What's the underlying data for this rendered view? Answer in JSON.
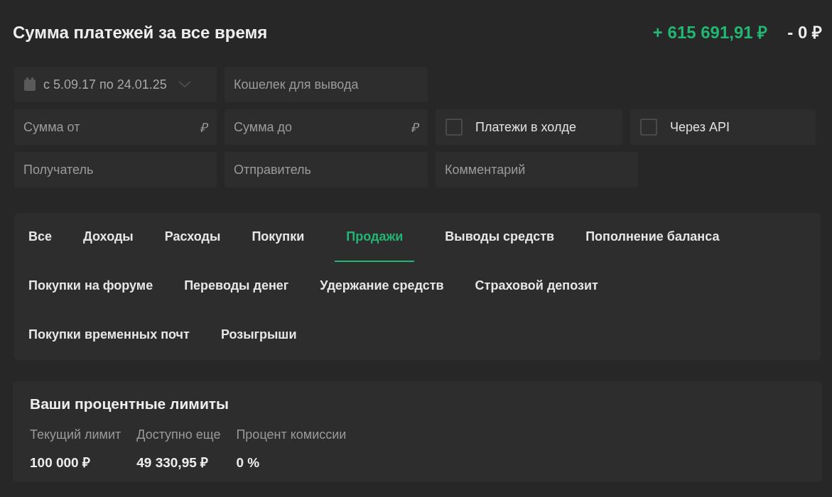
{
  "header": {
    "title": "Сумма платежей за все время",
    "income": "+ 615 691,91 ₽",
    "expense": "- 0 ₽"
  },
  "filters": {
    "date_range": {
      "value": "с 5.09.17 по 24.01.25"
    },
    "wallet": {
      "placeholder": "Кошелек для вывода"
    },
    "amount_from": {
      "placeholder": "Сумма от",
      "suffix": "₽"
    },
    "amount_to": {
      "placeholder": "Сумма до",
      "suffix": "₽"
    },
    "checkboxes": [
      {
        "label": "Платежи в холде",
        "checked": false
      },
      {
        "label": "Через API",
        "checked": false
      }
    ],
    "recipient": {
      "placeholder": "Получатель"
    },
    "sender": {
      "placeholder": "Отправитель"
    },
    "comment": {
      "placeholder": "Комментарий"
    }
  },
  "tabs": [
    {
      "label": "Все",
      "selected": false
    },
    {
      "label": "Доходы",
      "selected": false
    },
    {
      "label": "Расходы",
      "selected": false
    },
    {
      "label": "Покупки",
      "selected": false
    },
    {
      "label": "Продажи",
      "selected": true
    },
    {
      "label": "Выводы средств",
      "selected": false
    },
    {
      "label": "Пополнение баланса",
      "selected": false
    },
    {
      "label": "Покупки на форуме",
      "selected": false
    },
    {
      "label": "Переводы денег",
      "selected": false
    },
    {
      "label": "Удержание средств",
      "selected": false
    },
    {
      "label": "Страховой депозит",
      "selected": false
    },
    {
      "label": "Покупки временных почт",
      "selected": false
    },
    {
      "label": "Розыгрыши",
      "selected": false
    }
  ],
  "limits": {
    "title": "Ваши процентные лимиты",
    "items": [
      {
        "label": "Текущий лимит",
        "value": "100 000 ₽"
      },
      {
        "label": "Доступно еще",
        "value": "49 330,95 ₽"
      },
      {
        "label": "Процент комиссии",
        "value": "0 %"
      }
    ]
  }
}
